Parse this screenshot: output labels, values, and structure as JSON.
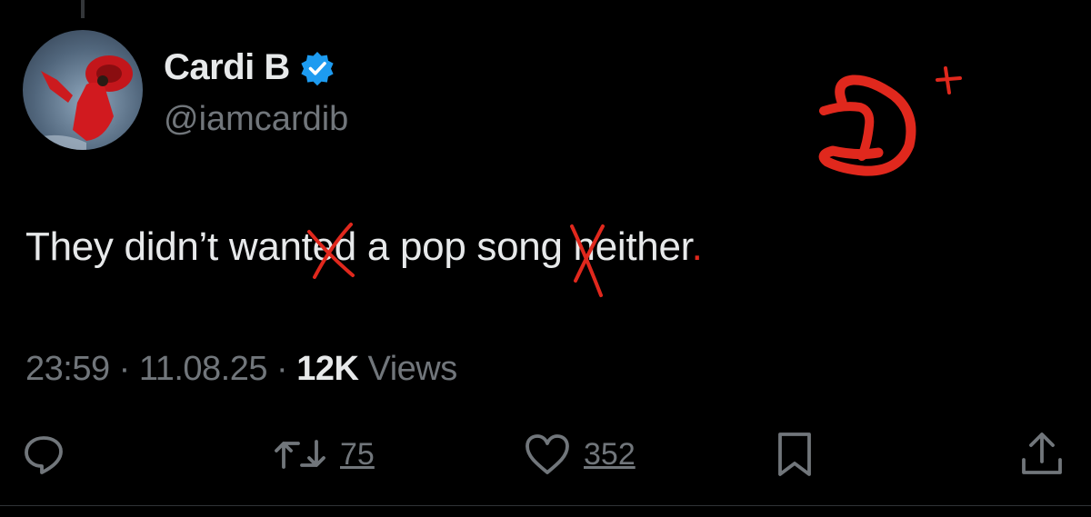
{
  "tweet": {
    "display_name": "Cardi B",
    "handle": "@iamcardib",
    "text_part1": "They didn’t want",
    "text_struck1": "ed",
    "text_part2": " a pop song ",
    "text_struck2": "n",
    "text_part3": "either",
    "text_period": ".",
    "time": "23:59",
    "sep": " · ",
    "date": "11.08.25",
    "views_count": "12K",
    "views_label": " Views"
  },
  "actions": {
    "reply_count": "",
    "retweet_count": "75",
    "like_count": "352",
    "bookmark_count": "",
    "share_count": ""
  },
  "annotation": {
    "grade": "D+",
    "color": "#e0281d"
  },
  "colors": {
    "background": "#000000",
    "text": "#e7e9ea",
    "muted": "#71767b",
    "verified": "#1d9bf0"
  },
  "icons": [
    "reply-icon",
    "retweet-icon",
    "like-icon",
    "bookmark-icon",
    "share-icon",
    "verified-badge-icon"
  ]
}
